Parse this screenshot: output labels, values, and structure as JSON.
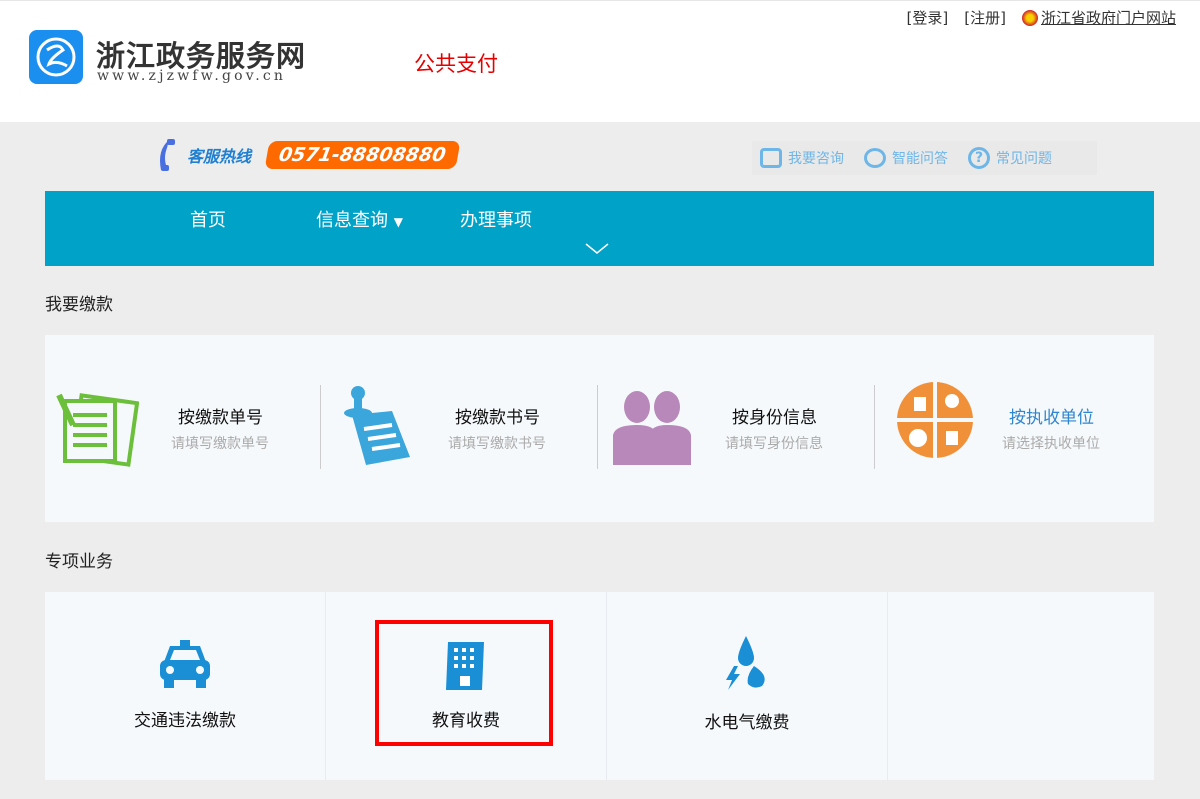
{
  "header": {
    "site_name": "浙江政务服务网",
    "site_url": "www.zjzwfw.gov.cn",
    "page_title": "公共支付",
    "links": {
      "login": "[登录]",
      "register": "[注册]",
      "gov_portal": "浙江省政府门户网站"
    }
  },
  "hotline": {
    "label": "客服热线",
    "number": "0571-88808880"
  },
  "help": [
    {
      "label": "我要咨询",
      "icon": "chat-icon"
    },
    {
      "label": "智能问答",
      "icon": "robot-icon"
    },
    {
      "label": "常见问题",
      "icon": "question-icon"
    }
  ],
  "nav": {
    "items": [
      "首页",
      "信息查询",
      "办理事项"
    ]
  },
  "pay_section": {
    "title": "我要缴款",
    "items": [
      {
        "title": "按缴款单号",
        "sub": "请填写缴款单号",
        "icon": "document-icon",
        "color": "#6cbf3a"
      },
      {
        "title": "按缴款书号",
        "sub": "请填写缴款书号",
        "icon": "pin-note-icon",
        "color": "#3ba6dc"
      },
      {
        "title": "按身份信息",
        "sub": "请填写身份信息",
        "icon": "people-icon",
        "color": "#b988bb"
      },
      {
        "title": "按执收单位",
        "sub": "请选择执收单位",
        "icon": "unit-icon",
        "color": "#f0913a"
      }
    ]
  },
  "special_section": {
    "title": "专项业务",
    "items": [
      {
        "title": "交通违法缴款",
        "icon": "taxi-icon"
      },
      {
        "title": "教育收费",
        "icon": "building-icon"
      },
      {
        "title": "水电气缴费",
        "icon": "utilities-icon"
      }
    ]
  },
  "colors": {
    "nav": "#00a2c8",
    "accent_icon": "#1a8fd6",
    "highlight": "#ff0000"
  }
}
